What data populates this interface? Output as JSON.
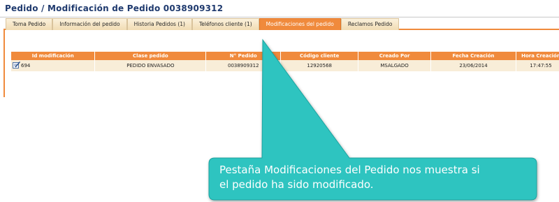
{
  "page": {
    "title": "Pedido / Modificación de Pedido 0038909312"
  },
  "tabs": [
    {
      "label": "Toma Pedido",
      "active": false
    },
    {
      "label": "Información del pedido",
      "active": false
    },
    {
      "label": "Historia Pedidos (1)",
      "active": false
    },
    {
      "label": "Teléfonos cliente (1)",
      "active": false
    },
    {
      "label": "Modificaciones del pedido",
      "active": true
    },
    {
      "label": "Reclamos Pedido",
      "active": false
    }
  ],
  "table": {
    "headers": [
      "Id modificación",
      "Clase pedido",
      "N° Pedido",
      "Código cliente",
      "Creado Por",
      "Fecha Creación",
      "Hora Creación"
    ],
    "rows": [
      [
        "694",
        "PEDIDO ENVASADO",
        "0038909312",
        "12920568",
        "MSALGADO",
        "23/06/2014",
        "17:47:55"
      ]
    ]
  },
  "callout": {
    "text_line1": "Pestaña Modificaciones del Pedido nos muestra si",
    "text_line2": "el pedido ha sido modificado."
  },
  "colors": {
    "accent": "#f08a3c",
    "title": "#1f3a6e",
    "callout": "#2ec4c0",
    "row_bg": "#f8edd8"
  },
  "icons": {
    "row_edit": "edit-icon"
  }
}
